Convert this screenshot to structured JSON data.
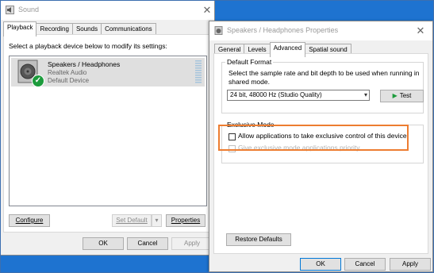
{
  "sound_window": {
    "title": "Sound",
    "close_glyph": "✕",
    "tabs": [
      {
        "label": "Playback",
        "active": true
      },
      {
        "label": "Recording"
      },
      {
        "label": "Sounds"
      },
      {
        "label": "Communications"
      }
    ],
    "instruction": "Select a playback device below to modify its settings:",
    "device": {
      "name": "Speakers / Headphones",
      "driver": "Realtek Audio",
      "status": "Default Device",
      "status_icon": "checkmark-icon"
    },
    "buttons": {
      "configure": "Configure",
      "set_default": "Set Default",
      "properties": "Properties",
      "ok": "OK",
      "cancel": "Cancel",
      "apply": "Apply"
    }
  },
  "props_window": {
    "title": "Speakers / Headphones Properties",
    "close_glyph": "✕",
    "tabs": [
      {
        "label": "General"
      },
      {
        "label": "Levels"
      },
      {
        "label": "Advanced",
        "active": true
      },
      {
        "label": "Spatial sound"
      }
    ],
    "default_format": {
      "legend": "Default Format",
      "description": "Select the sample rate and bit depth to be used when running in shared mode.",
      "selected": "24 bit, 48000 Hz (Studio Quality)",
      "test_button": "Test"
    },
    "exclusive_mode": {
      "legend": "Exclusive Mode",
      "allow_label": "Allow applications to take exclusive control of this device",
      "allow_checked": false,
      "priority_label": "Give exclusive mode applications priority",
      "priority_checked": false
    },
    "buttons": {
      "restore_defaults": "Restore Defaults",
      "ok": "OK",
      "cancel": "Cancel",
      "apply": "Apply"
    }
  },
  "colors": {
    "desktop": "#1e73d0",
    "highlight": "#ed7d31",
    "check_green": "#1c9b3c"
  }
}
